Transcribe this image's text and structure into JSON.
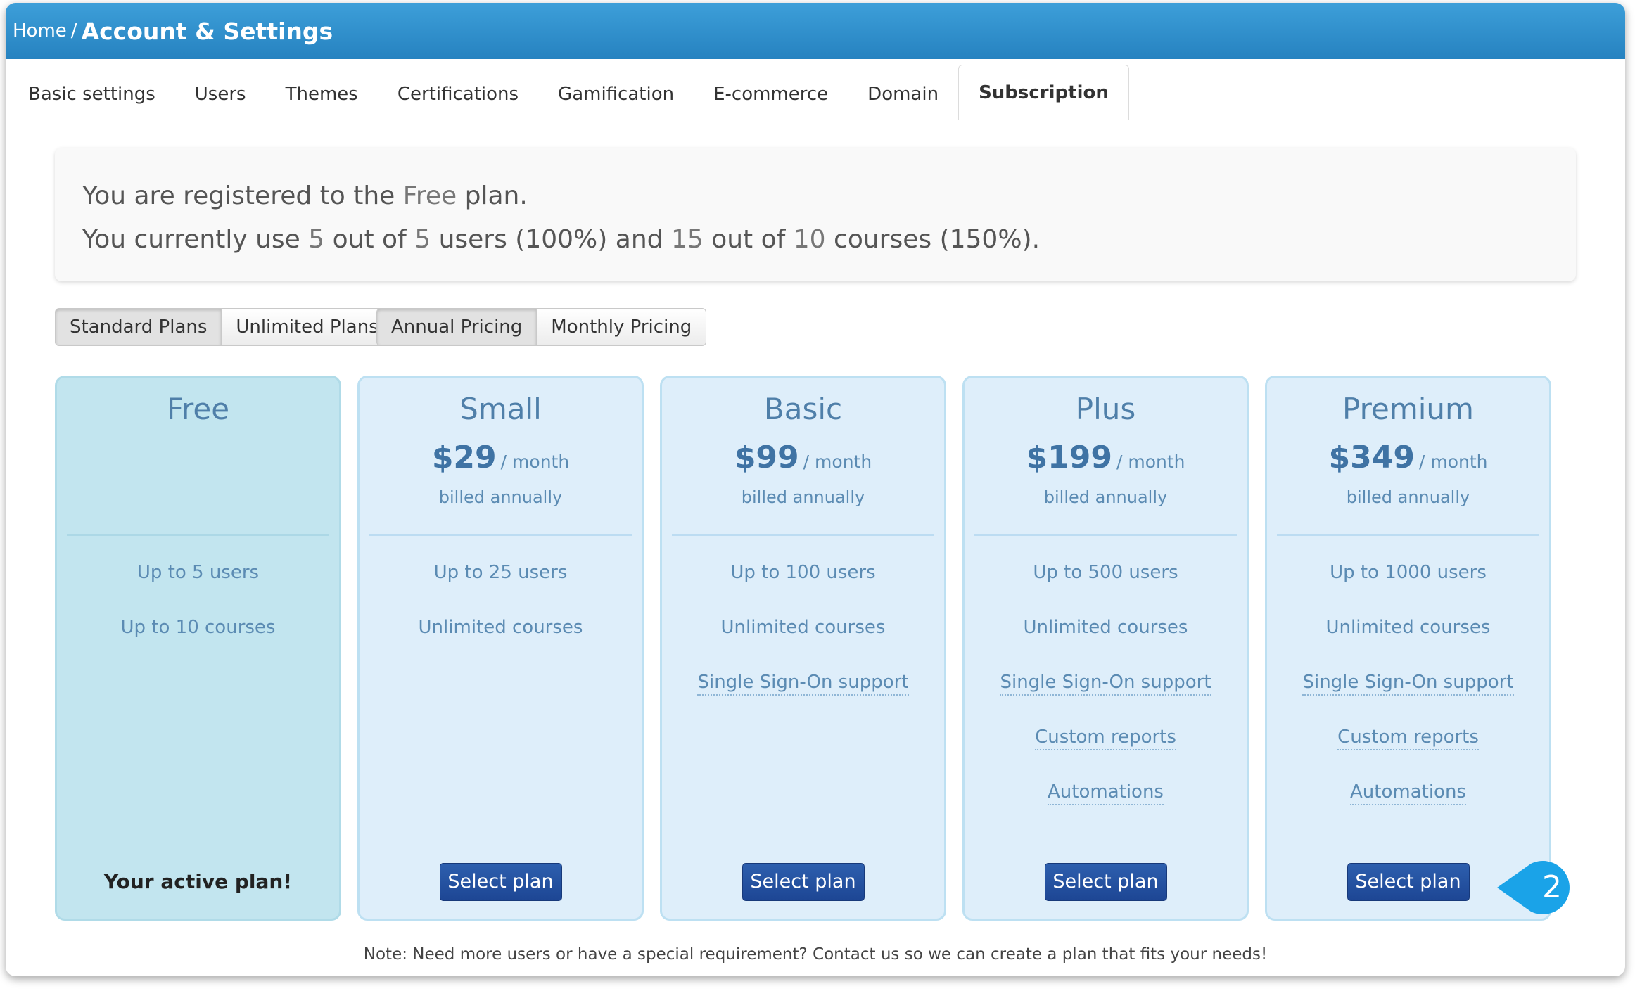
{
  "breadcrumb": {
    "home": "Home",
    "separator": "/",
    "current": "Account & Settings"
  },
  "tabs": [
    {
      "label": "Basic settings",
      "active": false
    },
    {
      "label": "Users",
      "active": false
    },
    {
      "label": "Themes",
      "active": false
    },
    {
      "label": "Certifications",
      "active": false
    },
    {
      "label": "Gamification",
      "active": false
    },
    {
      "label": "E-commerce",
      "active": false
    },
    {
      "label": "Domain",
      "active": false
    },
    {
      "label": "Subscription",
      "active": true
    }
  ],
  "status": {
    "line1_prefix": "You are registered to the",
    "plan_name": "Free",
    "line1_suffix": "plan.",
    "line2_prefix": "You currently use",
    "users_used": "5",
    "text_out_of": "out of",
    "users_total": "5",
    "users_pct": "users (100%) and",
    "courses_used": "15",
    "courses_total": "10",
    "courses_pct": "courses (150%)."
  },
  "plan_type_toggle": {
    "standard": "Standard Plans",
    "unlimited": "Unlimited Plans",
    "selected": "standard"
  },
  "pricing_toggle": {
    "annual": "Annual Pricing",
    "monthly": "Monthly Pricing",
    "selected": "annual"
  },
  "plans": [
    {
      "name": "Free",
      "features": [
        "Up to 5 users",
        "Up to 10 courses"
      ],
      "active_label": "Your active plan!"
    },
    {
      "name": "Small",
      "price": "$29",
      "per": "/ month",
      "billing": "billed annually",
      "features": [
        "Up to 25 users",
        "Unlimited courses"
      ],
      "button": "Select plan"
    },
    {
      "name": "Basic",
      "price": "$99",
      "per": "/ month",
      "billing": "billed annually",
      "features": [
        "Up to 100 users",
        "Unlimited courses",
        "Single Sign-On support"
      ],
      "button": "Select plan"
    },
    {
      "name": "Plus",
      "price": "$199",
      "per": "/ month",
      "billing": "billed annually",
      "features": [
        "Up to 500 users",
        "Unlimited courses",
        "Single Sign-On support",
        "Custom reports",
        "Automations"
      ],
      "button": "Select plan"
    },
    {
      "name": "Premium",
      "price": "$349",
      "per": "/ month",
      "billing": "billed annually",
      "features": [
        "Up to 1000 users",
        "Unlimited courses",
        "Single Sign-On support",
        "Custom reports",
        "Automations"
      ],
      "button": "Select plan"
    }
  ],
  "note": "Note: Need more users or have a special requirement? Contact us so we can create a plan that fits your needs!",
  "callout": {
    "number": "2",
    "color": "#1aa3e8"
  }
}
